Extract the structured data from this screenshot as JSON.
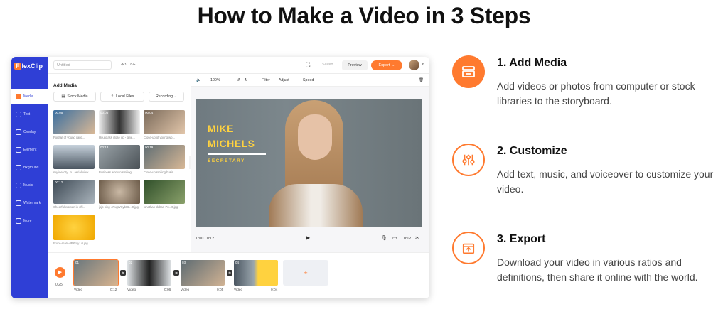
{
  "page": {
    "title": "How to Make a Video in 3 Steps"
  },
  "app": {
    "logo": "FlexClip",
    "sidebar": [
      {
        "label": "Media",
        "active": true
      },
      {
        "label": "Text"
      },
      {
        "label": "Overlay"
      },
      {
        "label": "Element"
      },
      {
        "label": "Bkground"
      },
      {
        "label": "Music"
      },
      {
        "label": "Watermark"
      },
      {
        "label": "More"
      }
    ],
    "topbar": {
      "project_name": "Untitled",
      "saved": "Saved",
      "preview": "Preview",
      "export": "Export →"
    },
    "media_panel": {
      "title": "Add Media",
      "buttons": [
        "Stock Media",
        "Local Files",
        "Recording ⌄"
      ],
      "items": [
        {
          "duration": "00:05",
          "caption": "Portrait of young cauc..."
        },
        {
          "duration": "00:06",
          "caption": "Hourglass close up - time..."
        },
        {
          "duration": "00:04",
          "caption": "Close-up of young wo..."
        },
        {
          "duration": "",
          "caption": "skyline-city...o...aerial view"
        },
        {
          "duration": "00:13",
          "caption": "Business woman smiling..."
        },
        {
          "duration": "00:19",
          "caption": "Close-up smiling busin..."
        },
        {
          "duration": "00:12",
          "caption": "Cheerful woman in offi..."
        },
        {
          "duration": "",
          "caption": "jojo-king-4RxgWKybHL...0.jpg"
        },
        {
          "duration": "",
          "caption": "jonathan-duban-Pu...0.jpg"
        },
        {
          "duration": "",
          "caption": "bruce-mars-0BlGay...0.jpg"
        }
      ]
    },
    "editor": {
      "toolbar": {
        "zoom": "100%",
        "filter": "Filter",
        "adjust": "Adjust",
        "speed": "Speed"
      },
      "overlay": {
        "line1": "MIKE",
        "line2": "MICHELS",
        "subtitle": "SECRETARY"
      },
      "playback": {
        "current": "0:00 / 0:12",
        "length": "0:12"
      }
    },
    "timeline": {
      "total": "0:25",
      "clips": [
        {
          "num": "01",
          "label": "Video",
          "duration": "0:12"
        },
        {
          "num": "02",
          "label": "Video",
          "duration": "0:06"
        },
        {
          "num": "03",
          "label": "Video",
          "duration": "0:05"
        },
        {
          "num": "04",
          "label": "Video",
          "duration": "0:04"
        }
      ],
      "add": "+"
    }
  },
  "steps": [
    {
      "title": "1. Add Media",
      "description": "Add videos or photos from computer or stock libraries to the storyboard.",
      "icon": "media-library-icon"
    },
    {
      "title": "2. Customize",
      "description": "Add text, music, and voiceover to customize your video.",
      "icon": "sliders-icon"
    },
    {
      "title": "3. Export",
      "description": "Download your video in various ratios and definitions, then share it online with the world.",
      "icon": "export-icon"
    }
  ],
  "colors": {
    "accent": "#ff7a2f",
    "sidebar": "#2f3fd6",
    "overlay_text": "#ffd23f"
  }
}
